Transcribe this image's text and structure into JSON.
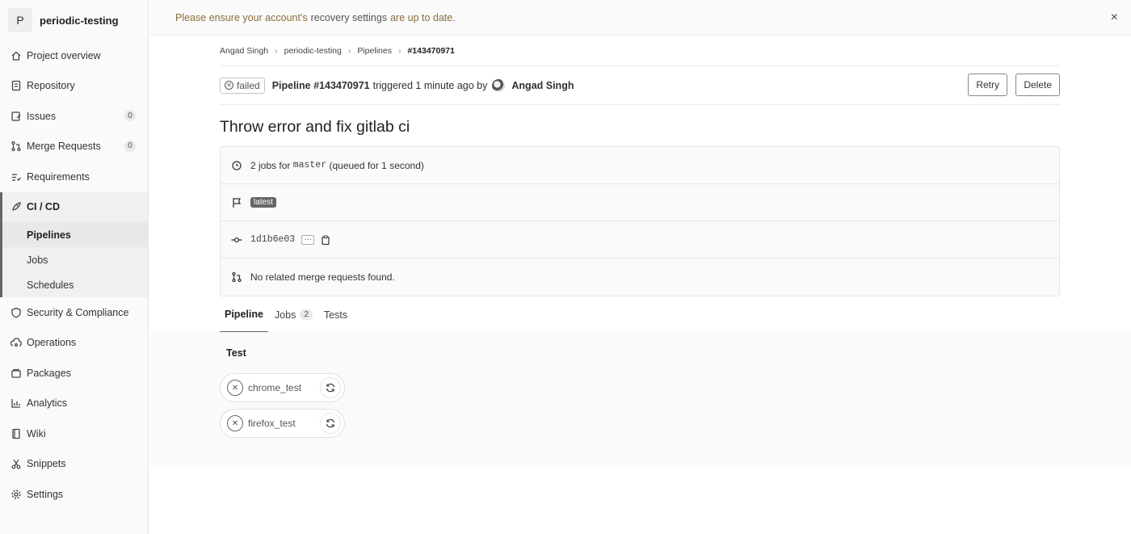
{
  "project": {
    "avatar_letter": "P",
    "name": "periodic-testing"
  },
  "sidebar": {
    "items": [
      {
        "label": "Project overview",
        "icon": "home-icon"
      },
      {
        "label": "Repository",
        "icon": "book-icon"
      },
      {
        "label": "Issues",
        "icon": "issues-icon",
        "count": "0"
      },
      {
        "label": "Merge Requests",
        "icon": "merge-request-icon",
        "count": "0"
      },
      {
        "label": "Requirements",
        "icon": "requirements-icon"
      },
      {
        "label": "CI / CD",
        "icon": "rocket-icon"
      },
      {
        "label": "Security & Compliance",
        "icon": "shield-icon"
      },
      {
        "label": "Operations",
        "icon": "cloud-gear-icon"
      },
      {
        "label": "Packages",
        "icon": "package-icon"
      },
      {
        "label": "Analytics",
        "icon": "chart-icon"
      },
      {
        "label": "Wiki",
        "icon": "book-closed-icon"
      },
      {
        "label": "Snippets",
        "icon": "scissors-icon"
      },
      {
        "label": "Settings",
        "icon": "gear-icon"
      }
    ],
    "cicd_sub": [
      "Pipelines",
      "Jobs",
      "Schedules"
    ]
  },
  "alert": {
    "part1": "Please ensure your account's",
    "part2": "recovery settings",
    "part3": "are up to date.",
    "close": "×"
  },
  "breadcrumb": [
    "Angad Singh",
    "periodic-testing",
    "Pipelines",
    "#143470971"
  ],
  "pipeline": {
    "status": "failed",
    "id_label": "Pipeline #143470971",
    "triggered": "triggered 1 minute ago by",
    "user": "Angad Singh",
    "retry_label": "Retry",
    "delete_label": "Delete",
    "title": "Throw error and fix gitlab ci"
  },
  "info": {
    "jobs_prefix": "2 jobs for",
    "branch": "master",
    "jobs_suffix": "(queued for 1 second)",
    "tag": "latest",
    "sha": "1d1b6e03",
    "ellipsis": "···",
    "merge_requests": "No related merge requests found."
  },
  "tabs": [
    {
      "label": "Pipeline"
    },
    {
      "label": "Jobs",
      "count": "2"
    },
    {
      "label": "Tests"
    }
  ],
  "stage": {
    "name": "Test",
    "jobs": [
      "chrome_test",
      "firefox_test"
    ]
  }
}
